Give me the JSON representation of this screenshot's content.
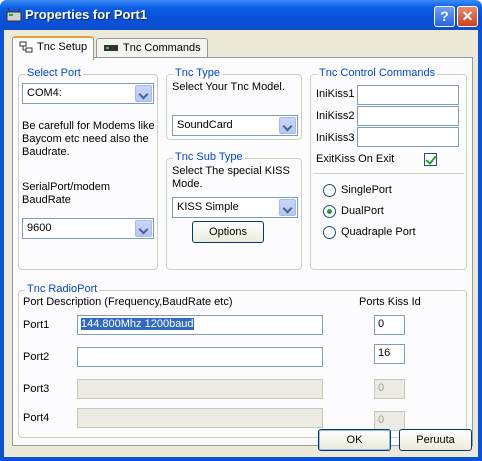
{
  "window": {
    "title": "Properties for Port1",
    "help_label": "?",
    "close_label": "✕"
  },
  "tabs": [
    {
      "label": "Tnc Setup",
      "icon": "network-icon",
      "active": true
    },
    {
      "label": "Tnc Commands",
      "icon": "modem-icon",
      "active": false
    }
  ],
  "select_port": {
    "title": "Select Port",
    "port_value": "COM4:",
    "note_lines": [
      "Be carefull for Modems like",
      "Baycom etc need also the",
      "Baudrate."
    ],
    "baud_label_lines": [
      "SerialPort/modem",
      "BaudRate"
    ],
    "baud_value": "9600"
  },
  "tnc_type": {
    "title": "Tnc Type",
    "description": "Select Your Tnc Model.",
    "value": "SoundCard"
  },
  "tnc_sub_type": {
    "title": "Tnc Sub Type",
    "description_lines": [
      "Select The special KISS",
      "Mode."
    ],
    "value": "KISS Simple",
    "options_label": "Options"
  },
  "control_commands": {
    "title": "Tnc Control Commands",
    "inikiss1_label": "IniKiss1",
    "inikiss2_label": "IniKiss2",
    "inikiss3_label": "IniKiss3",
    "inikiss1_value": "",
    "inikiss2_value": "",
    "inikiss3_value": "",
    "exitkiss_label": "ExitKiss On Exit",
    "exitkiss_checked": true,
    "radios": [
      {
        "label": "SinglePort",
        "checked": false
      },
      {
        "label": "DualPort",
        "checked": true
      },
      {
        "label": "Quadraple Port",
        "checked": false
      }
    ]
  },
  "radio_port": {
    "title": "Tnc RadioPort",
    "desc_header": "Port Description (Frequency,BaudRate etc)",
    "kiss_header": "Ports Kiss Id",
    "ports": [
      {
        "label": "Port1",
        "description": "144.800Mhz 1200baud",
        "kiss_id": "0",
        "enabled": true
      },
      {
        "label": "Port2",
        "description": "",
        "kiss_id": "16",
        "enabled": true
      },
      {
        "label": "Port3",
        "description": "",
        "kiss_id": "0",
        "enabled": false
      },
      {
        "label": "Port4",
        "description": "",
        "kiss_id": "0",
        "enabled": false
      }
    ]
  },
  "footer": {
    "ok_label": "OK",
    "cancel_label": "Peruuta"
  }
}
